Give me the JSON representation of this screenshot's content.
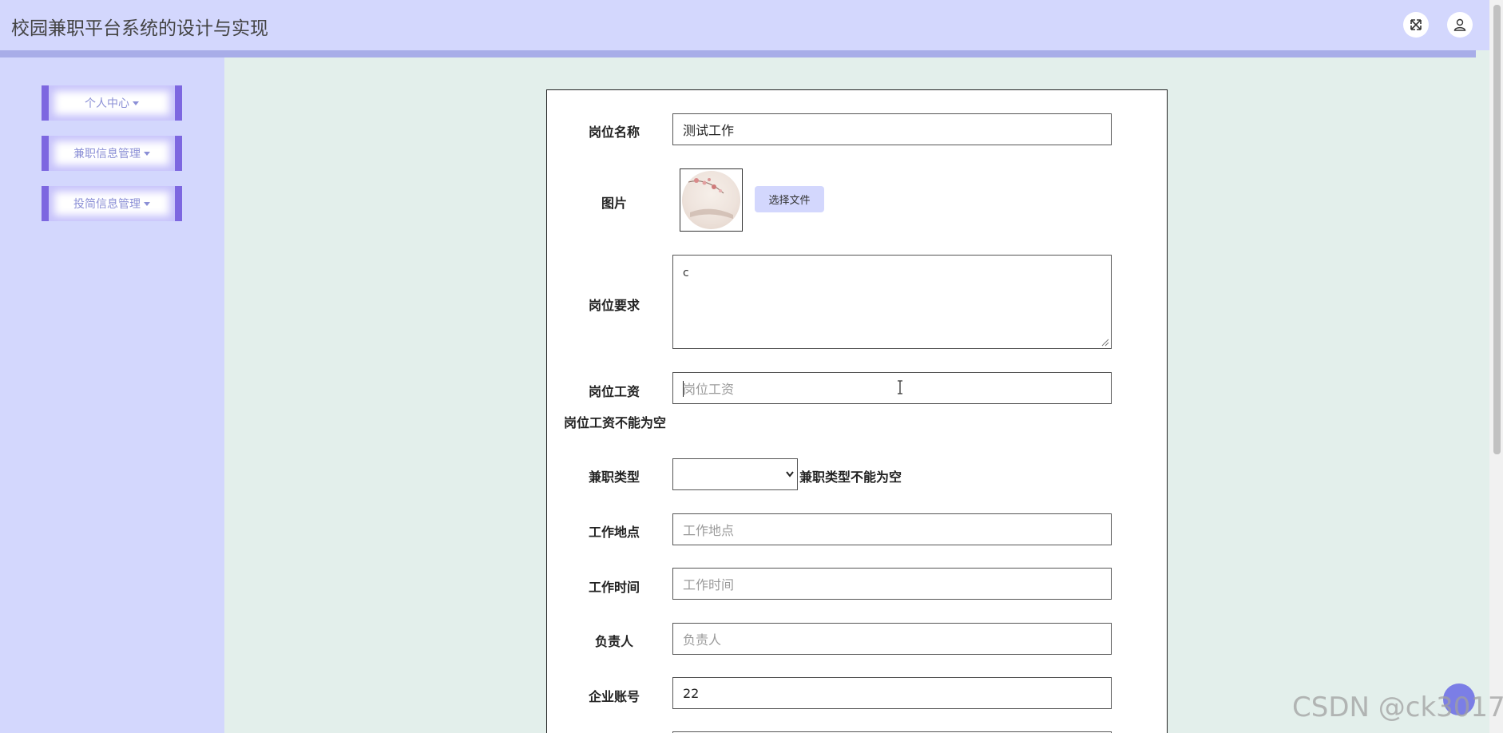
{
  "header": {
    "title": "校园兼职平台系统的设计与实现",
    "fullscreen_icon": "expand-arrows-icon",
    "user_icon": "user-icon"
  },
  "sidebar": {
    "items": [
      {
        "label": "个人中心"
      },
      {
        "label": "兼职信息管理"
      },
      {
        "label": "投简信息管理"
      }
    ]
  },
  "form": {
    "job_name": {
      "label": "岗位名称",
      "value": "测试工作"
    },
    "image": {
      "label": "图片",
      "button": "选择文件"
    },
    "requirements": {
      "label": "岗位要求",
      "value": "c"
    },
    "salary": {
      "label": "岗位工资",
      "placeholder": "岗位工资",
      "error": "岗位工资不能为空"
    },
    "job_type": {
      "label": "兼职类型",
      "value": "",
      "error": "兼职类型不能为空"
    },
    "location": {
      "label": "工作地点",
      "placeholder": "工作地点"
    },
    "work_time": {
      "label": "工作时间",
      "placeholder": "工作时间"
    },
    "manager": {
      "label": "负责人",
      "placeholder": "负责人"
    },
    "company_account": {
      "label": "企业账号",
      "value": "22"
    }
  },
  "watermark": "CSDN @ck3017",
  "colors": {
    "header_bg": "#d3d7fd",
    "sidebar_accent": "#7d67e0",
    "content_bg": "#e3efeb"
  }
}
